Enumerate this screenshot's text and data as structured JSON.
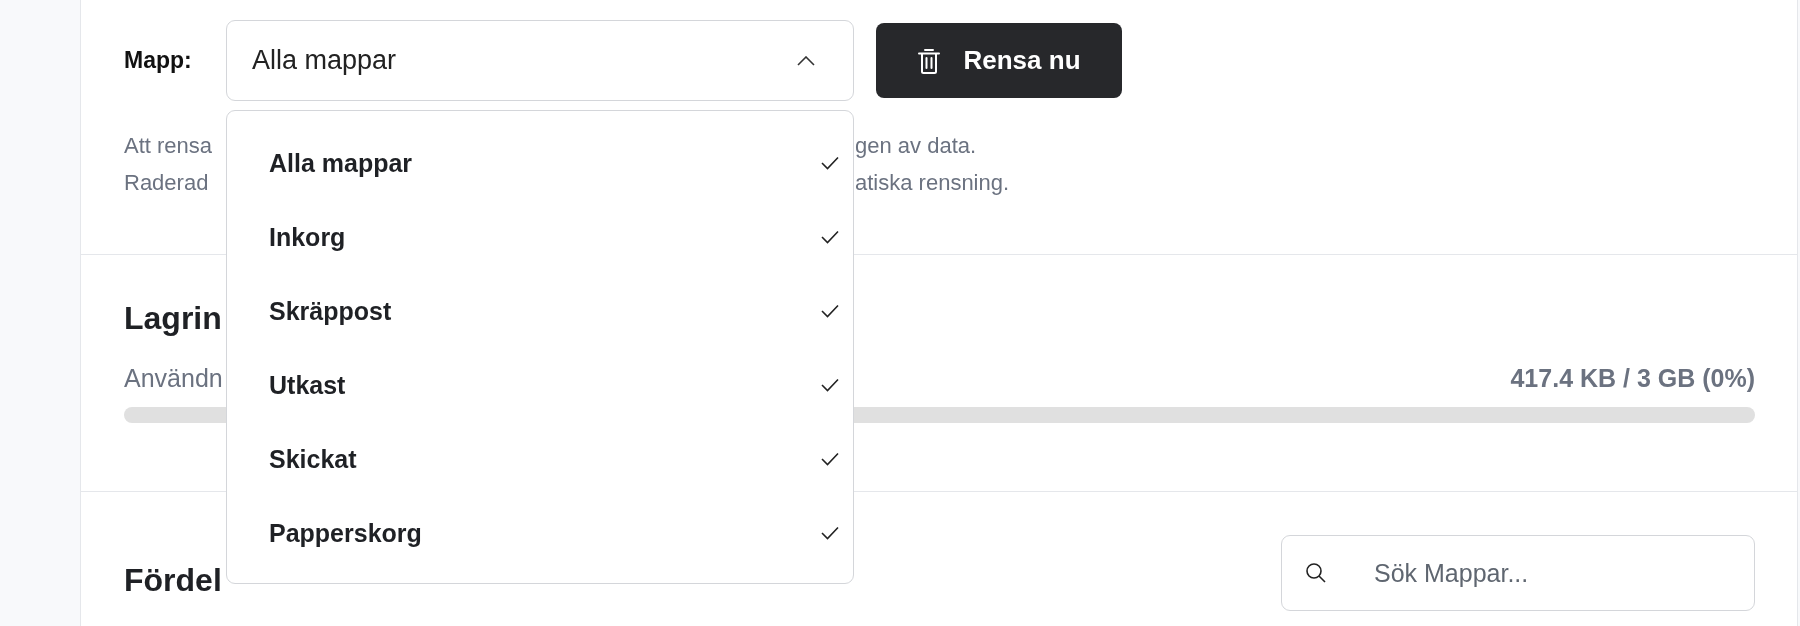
{
  "cleanup": {
    "folder_label": "Mapp:",
    "folder_select": {
      "value": "Alla mappar",
      "expanded": true
    },
    "button": "Rensa nu",
    "description_lines": [
      {
        "left": "Att rensa",
        "right": "gen av data."
      },
      {
        "left": "Raderad",
        "right": "atiska rensning."
      }
    ]
  },
  "dropdown": {
    "items": [
      {
        "label": "Alla mappar",
        "checked": true
      },
      {
        "label": "Inkorg",
        "checked": true
      },
      {
        "label": "Skräppost",
        "checked": true
      },
      {
        "label": "Utkast",
        "checked": true
      },
      {
        "label": "Skickat",
        "checked": true
      },
      {
        "label": "Papperskorg",
        "checked": true
      }
    ]
  },
  "storage": {
    "title": "Lagrin",
    "usage_label": "Användn",
    "usage_value": "417.4 KB / 3 GB (0%)",
    "level": 0
  },
  "distribution": {
    "title": "Fördel",
    "search": {
      "placeholder": "Sök Mappar..."
    }
  }
}
